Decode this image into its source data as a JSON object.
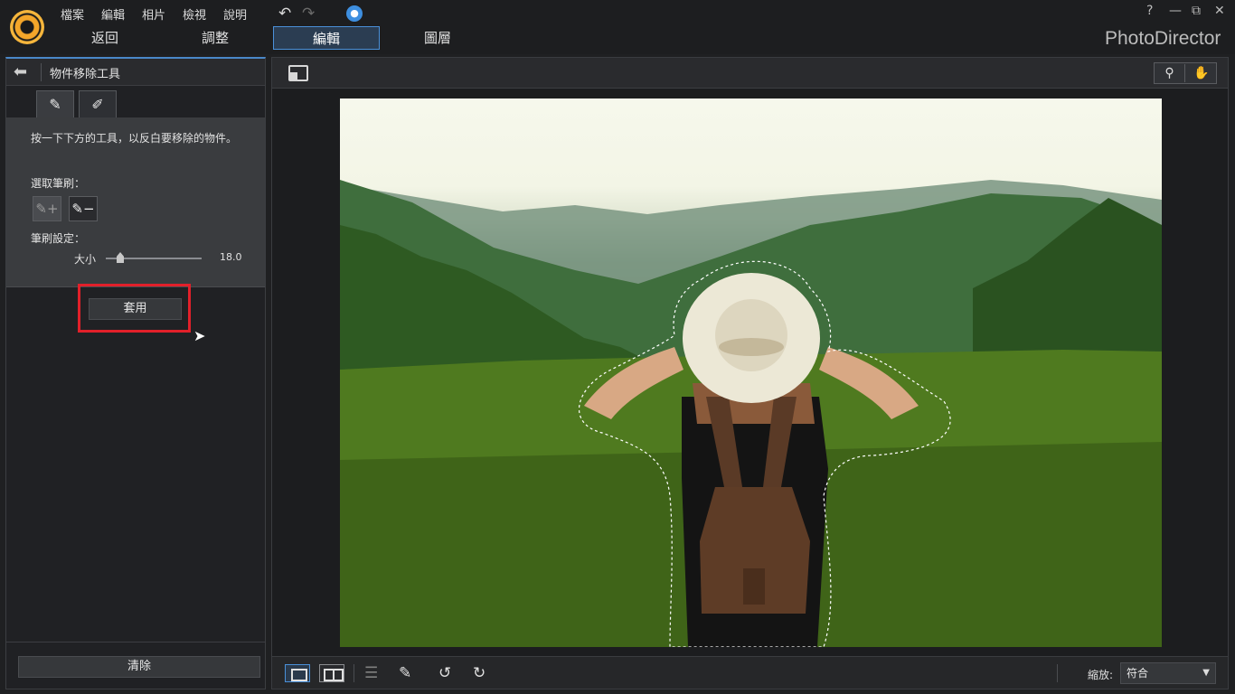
{
  "app": {
    "brand": "PhotoDirector",
    "menu": [
      "檔案",
      "編輯",
      "相片",
      "檢視",
      "說明"
    ],
    "tabs": [
      "返回",
      "調整",
      "編輯",
      "圖層"
    ],
    "active_tab": "編輯",
    "help": "?",
    "minimize": "—",
    "restore": "⧉",
    "close": "✕"
  },
  "panel": {
    "title": "物件移除工具",
    "instruction": "按一下下方的工具，以反白要移除的物件。",
    "brush_label": "選取筆刷：",
    "setting_label": "筆刷設定：",
    "size_label": "大小",
    "size_value": "18.0",
    "size_fraction": 0.17,
    "apply_label": "套用",
    "clear_label": "清除"
  },
  "bottom": {
    "zoom_label": "縮放:",
    "zoom_value": "符合"
  },
  "icons": {
    "back": "back-arrow-icon",
    "brush_tab_1": "brush-select-icon",
    "brush_tab_2": "brush-erase-icon",
    "magnifier": "magnifier-icon",
    "hand": "hand-icon",
    "undo": "undo-icon",
    "redo": "redo-icon",
    "rotate_left": "rotate-left-icon",
    "rotate_right": "rotate-right-icon"
  },
  "colors": {
    "accent": "#4a90d9",
    "highlight": "#e2202a",
    "logo": "#f4a62a"
  }
}
